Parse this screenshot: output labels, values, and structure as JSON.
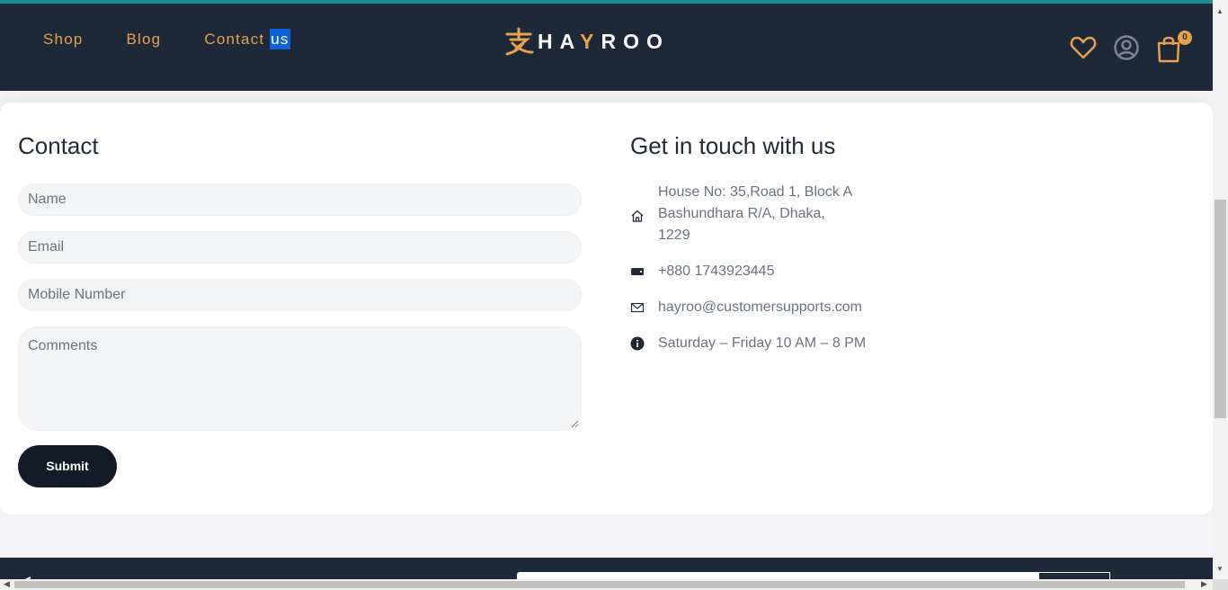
{
  "header": {
    "nav": [
      {
        "label": "Shop"
      },
      {
        "label": "Blog"
      },
      {
        "label_main": "Contact ",
        "label_selected": "us"
      }
    ],
    "logo": {
      "text_a": "HA",
      "text_y": "Y",
      "text_b": "ROO"
    },
    "cart_count": "0",
    "accent_color": "#e9a14a",
    "bg_color": "#1d2838"
  },
  "form": {
    "title": "Contact",
    "name_placeholder": "Name",
    "email_placeholder": "Email",
    "mobile_placeholder": "Mobile Number",
    "comments_placeholder": "Comments",
    "submit_label": "Submit"
  },
  "info": {
    "title": "Get in touch with us",
    "address_lines": [
      "House No: 35,Road 1, Block A",
      "Bashundhara R/A, Dhaka,",
      "1229"
    ],
    "phone": "+880 1743923445",
    "email": "hayroo@customersupports.com",
    "hours": "Saturday – Friday 10 AM – 8 PM"
  }
}
